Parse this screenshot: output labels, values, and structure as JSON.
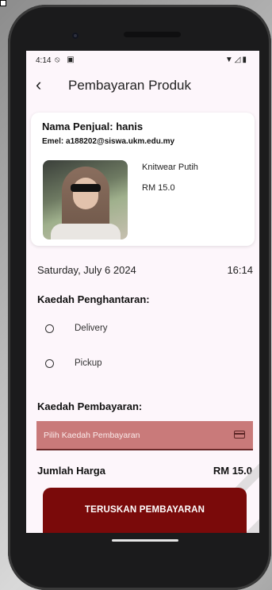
{
  "status_bar": {
    "time": "4:14",
    "left_icons": "⦸ ▣",
    "right_icons": "▼◿▮"
  },
  "app_bar": {
    "title": "Pembayaran Produk"
  },
  "seller_card": {
    "seller_name": "Nama Penjual: hanis",
    "email": "Emel: a188202@siswa.ukm.edu.my",
    "product_name": "Knitwear Putih",
    "product_price": "RM 15.0"
  },
  "datetime": {
    "date": "Saturday, July 6 2024",
    "time": "16:14"
  },
  "delivery": {
    "heading": "Kaedah Penghantaran:",
    "options": [
      "Delivery",
      "Pickup"
    ]
  },
  "payment": {
    "heading": "Kaedah Pembayaran:",
    "placeholder": "Pilih Kaedah Pembayaran"
  },
  "total": {
    "label": "Jumlah Harga",
    "value": "RM 15.0"
  },
  "button": {
    "label": "TERUSKAN PEMBAYARAN"
  },
  "colors": {
    "primary": "#7a0a0a",
    "select_bg": "#c97a7a",
    "screen_bg": "#fdf6fb"
  }
}
